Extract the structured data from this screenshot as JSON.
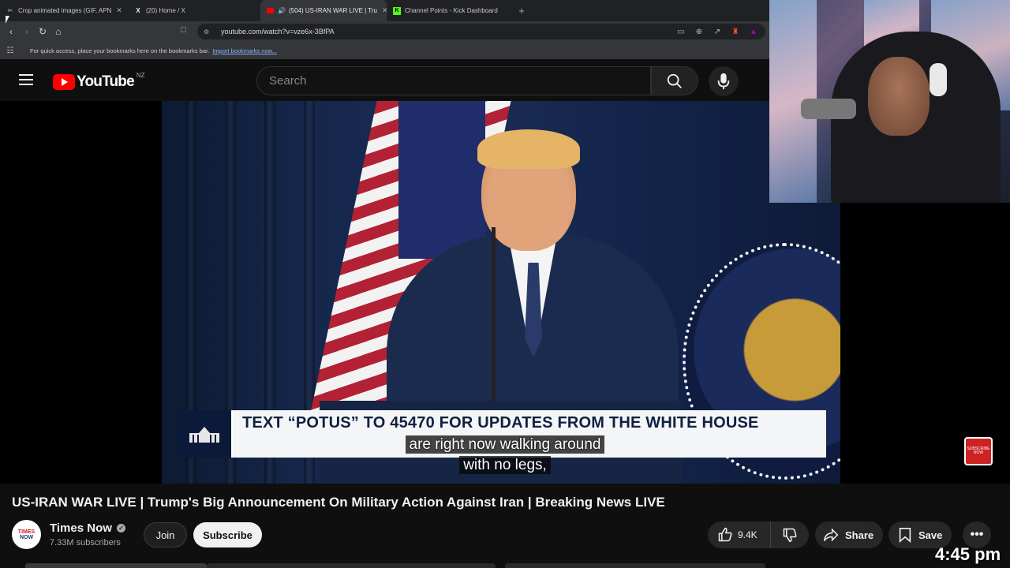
{
  "browser": {
    "tabs": [
      {
        "title": "Crop animated images (GIF, APN",
        "icon": "crop-tool-icon",
        "active": false
      },
      {
        "title": "(20) Home / X",
        "icon": "x-logo-icon",
        "active": false
      },
      {
        "title": "(504) US-IRAN WAR LIVE | Tru",
        "icon": "youtube-icon",
        "active": true
      },
      {
        "title": "Channel Points - Kick Dashboard",
        "icon": "kick-icon",
        "active": false
      }
    ],
    "new_tab_label": "+",
    "url": "youtube.com/watch?v=vze6x-3BfPA",
    "bookmarks_bar": {
      "message": "For quick access, place your bookmarks here on the bookmarks bar.",
      "import_link": "Import bookmarks now..."
    }
  },
  "youtube": {
    "logo_text": "YouTube",
    "region": "NZ",
    "search_placeholder": "Search"
  },
  "video": {
    "lower_third": "TEXT “POTUS” TO 45470 FOR UPDATES FROM THE WHITE HOUSE",
    "caption_line_1": "are right now walking around",
    "caption_line_2": "with no legs,",
    "watermark_line_1": "SUBSCRIBE",
    "watermark_line_2": "NOW",
    "title": "US-IRAN WAR LIVE | Trump's Big Announcement On Military Action Against Iran | Breaking News LIVE"
  },
  "channel": {
    "avatar_top": "TIMES",
    "avatar_bottom": "NOW",
    "name": "Times Now",
    "subscribers": "7.33M subscribers",
    "join_label": "Join",
    "subscribe_label": "Subscribe"
  },
  "actions": {
    "likes": "9.4K",
    "share_label": "Share",
    "save_label": "Save",
    "more_label": "•••"
  },
  "overlay": {
    "clock": "4:45 pm"
  },
  "colors": {
    "yt_red": "#ff0000",
    "background": "#0f0f0f",
    "chrome_dark": "#202124",
    "link_blue": "#8ab4f8"
  }
}
